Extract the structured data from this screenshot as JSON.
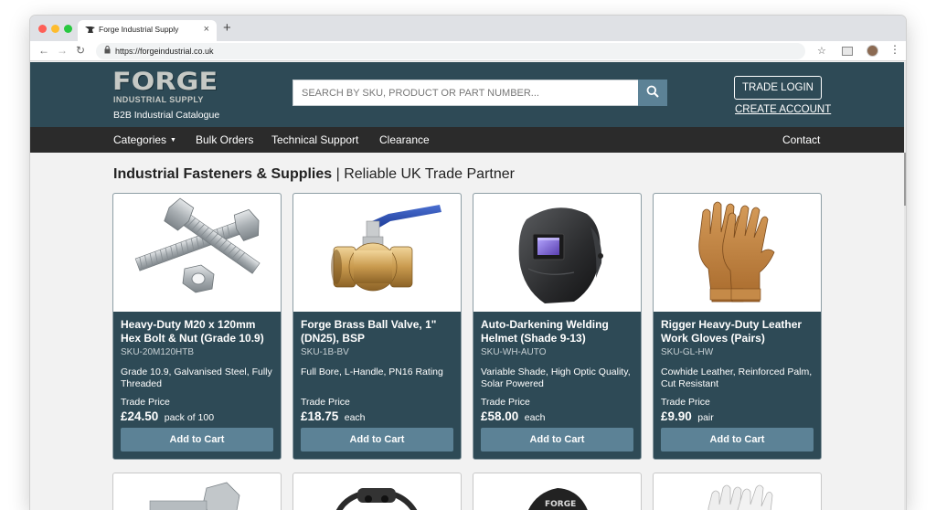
{
  "browser": {
    "tab_title": "Forge Industrial Supply",
    "url": "https://forgeindustrial.co.uk"
  },
  "header": {
    "logo_text": "FORGE",
    "logo_sub": "INDUSTRIAL SUPPLY",
    "tagline": "B2B Industrial Catalogue",
    "search_placeholder": "SEARCH BY SKU, PRODUCT OR PART NUMBER...",
    "trade_login": "TRADE LOGIN",
    "create_account": "CREATE ACCOUNT"
  },
  "nav": {
    "items": [
      "Categories",
      "Bulk Orders",
      "Technical Support",
      "Clearance"
    ],
    "contact": "Contact"
  },
  "page": {
    "heading_bold": "Industrial Fasteners & Supplies",
    "heading_rest": " | Reliable UK Trade Partner"
  },
  "products": [
    {
      "name": "Heavy-Duty M20 x 120mm Hex Bolt & Nut (Grade 10.9)",
      "sku": "SKU-20M120HTB",
      "desc": "Grade 10.9, Galvanised Steel, Fully Threaded",
      "price_label": "Trade Price",
      "price": "£24.50",
      "unit": "pack of 100",
      "button": "Add to Cart"
    },
    {
      "name": "Forge Brass Ball Valve, 1\" (DN25), BSP",
      "sku": "SKU-1B-BV",
      "desc": "Full Bore, L-Handle, PN16 Rating",
      "price_label": "Trade Price",
      "price": "£18.75",
      "unit": "each",
      "button": "Add to Cart"
    },
    {
      "name": "Auto-Darkening Welding Helmet (Shade 9-13)",
      "sku": "SKU-WH-AUTO",
      "desc": "Variable Shade, High Optic Quality, Solar Powered",
      "price_label": "Trade Price",
      "price": "£58.00",
      "unit": "each",
      "button": "Add to Cart"
    },
    {
      "name": "Rigger Heavy-Duty Leather Work Gloves (Pairs)",
      "sku": "SKU-GL-HW",
      "desc": "Cowhide Leather, Reinforced Palm, Cut Resistant",
      "price_label": "Trade Price",
      "price": "£9.90",
      "unit": "pair",
      "button": "Add to Cart"
    }
  ],
  "second_row_helmet_text": "FORGE",
  "colors": {
    "header_bg": "#2e4a56",
    "nav_bg": "#2b2b2b",
    "button_bg": "#5c8296"
  }
}
